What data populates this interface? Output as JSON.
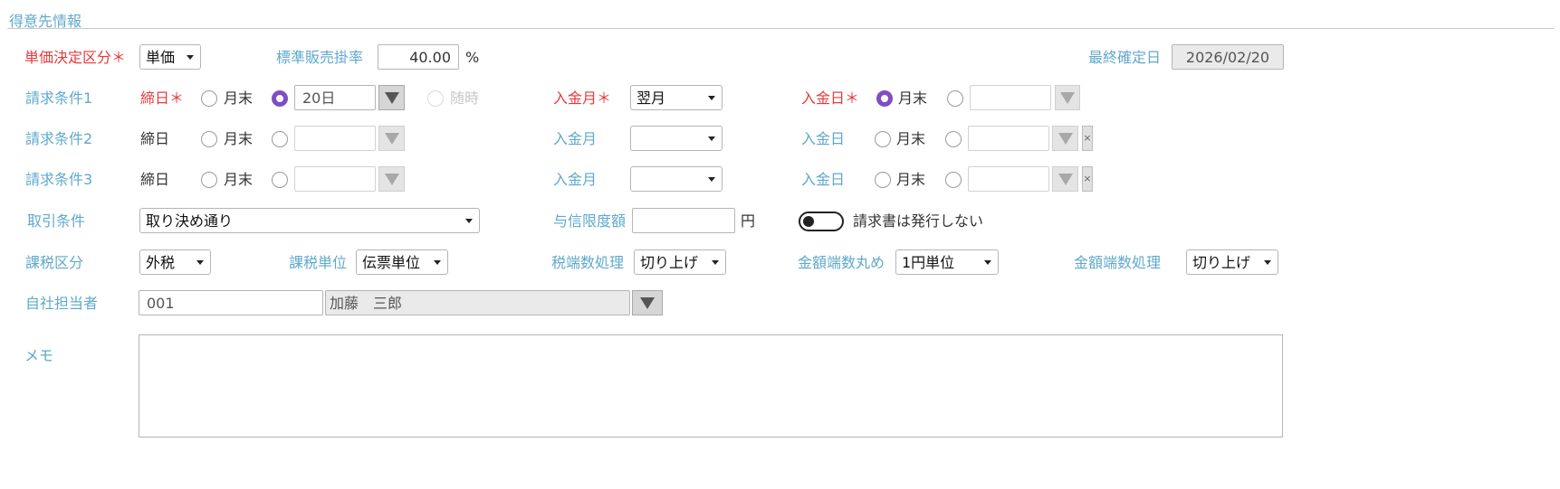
{
  "section_title": "得意先情報",
  "row1": {
    "unit_price_label": "単価決定区分",
    "req_mark": "＊",
    "unit_price_value": "単価",
    "std_rate_label": "標準販売掛率",
    "std_rate_value": "40.00",
    "percent": "%",
    "last_confirm_label": "最終確定日",
    "last_confirm_value": "2026/02/20"
  },
  "billing1": {
    "label": "請求条件1",
    "closing_label": "締日",
    "month_end": "月末",
    "closing_day": "20日",
    "anytime": "随時",
    "pay_month_label": "入金月",
    "pay_month_value": "翌月",
    "pay_day_label": "入金日",
    "pay_month_end": "月末",
    "pay_day_value": ""
  },
  "billing2": {
    "label": "請求条件2",
    "closing_label": "締日",
    "month_end": "月末",
    "closing_day": "",
    "pay_month_label": "入金月",
    "pay_month_value": "",
    "pay_day_label": "入金日",
    "pay_month_end": "月末",
    "pay_day_value": "",
    "clear": "×"
  },
  "billing3": {
    "label": "請求条件3",
    "closing_label": "締日",
    "month_end": "月末",
    "closing_day": "",
    "pay_month_label": "入金月",
    "pay_month_value": "",
    "pay_day_label": "入金日",
    "pay_month_end": "月末",
    "pay_day_value": "",
    "clear": "×"
  },
  "trade": {
    "label": "取引条件",
    "value": "取り決め通り",
    "credit_label": "与信限度額",
    "credit_value": "",
    "yen": "円",
    "invoice_toggle_label": "請求書は発行しない"
  },
  "tax": {
    "tax_class_label": "課税区分",
    "tax_class_value": "外税",
    "tax_unit_label": "課税単位",
    "tax_unit_value": "伝票単位",
    "tax_rounding_label": "税端数処理",
    "tax_rounding_value": "切り上げ",
    "amount_rounding_unit_label": "金額端数丸め",
    "amount_rounding_unit_value": "1円単位",
    "amount_rounding_label": "金額端数処理",
    "amount_rounding_value": "切り上げ"
  },
  "staff": {
    "label": "自社担当者",
    "code": "001",
    "name": "加藤　三郎"
  },
  "memo": {
    "label": "メモ",
    "value": ""
  },
  "colors": {
    "label_blue": "#5fa9cc",
    "required_red": "#e8393b",
    "radio_selected": "#7d4fc1"
  }
}
